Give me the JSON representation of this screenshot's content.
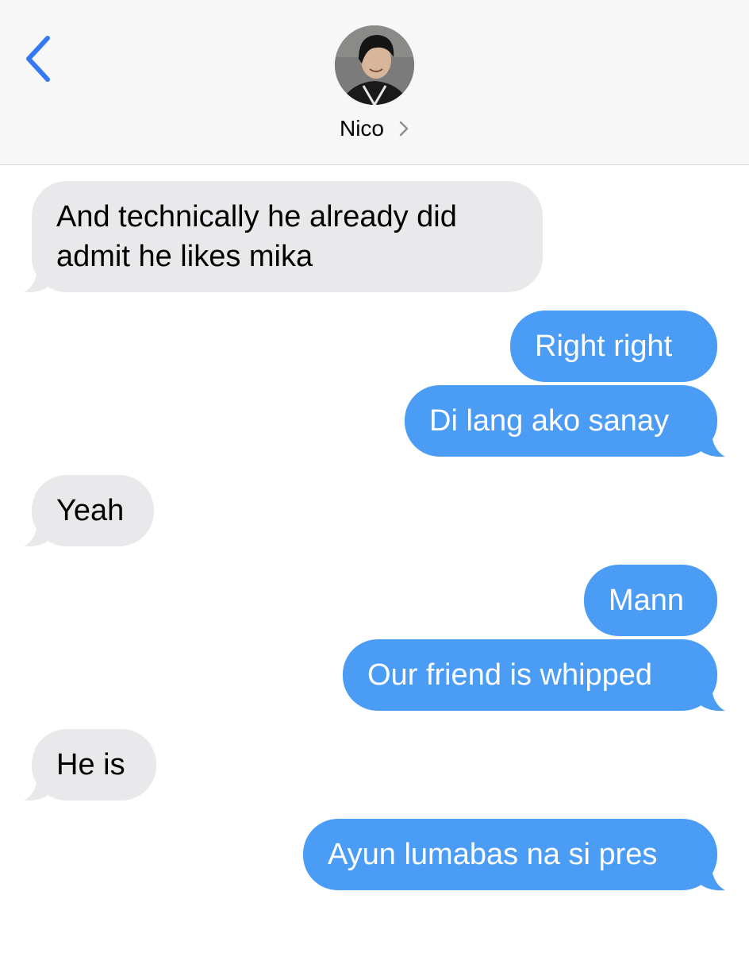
{
  "header": {
    "contact_name": "Nico",
    "chevron": "chevron-right-icon",
    "back_icon": "chevron-left-icon",
    "accent": "#3478f6"
  },
  "colors": {
    "incoming_bubble": "#e9e9eb",
    "outgoing_bubble": "#4a9cf5",
    "header_bg": "#f7f7f7"
  },
  "messages": [
    {
      "direction": "incoming",
      "lines": [
        "And technically he already did",
        "admit he likes mika"
      ]
    },
    {
      "direction": "outgoing",
      "lines": [
        "Right right"
      ]
    },
    {
      "direction": "outgoing",
      "lines": [
        "Di lang ako sanay"
      ]
    },
    {
      "direction": "incoming",
      "lines": [
        "Yeah"
      ]
    },
    {
      "direction": "outgoing",
      "lines": [
        "Mann"
      ]
    },
    {
      "direction": "outgoing",
      "lines": [
        "Our friend is whipped"
      ]
    },
    {
      "direction": "incoming",
      "lines": [
        "He is"
      ]
    },
    {
      "direction": "outgoing",
      "lines": [
        "Ayun lumabas na si pres"
      ]
    }
  ]
}
